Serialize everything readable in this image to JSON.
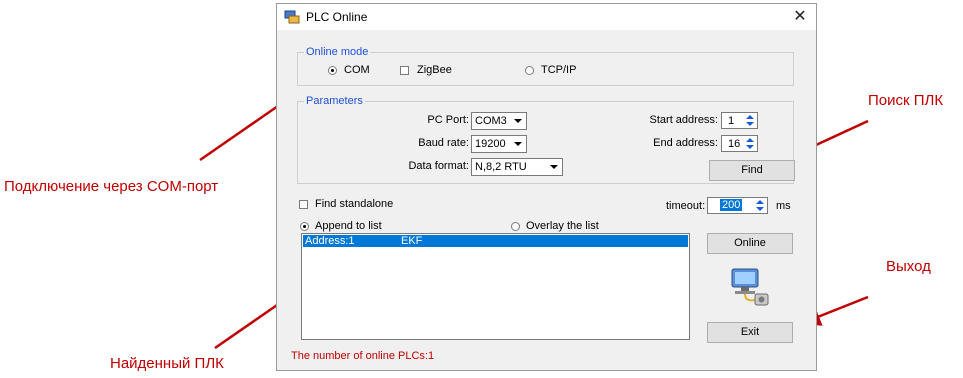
{
  "window": {
    "title": "PLC Online",
    "close_glyph": "✕"
  },
  "online_mode": {
    "legend": "Online mode",
    "options": [
      {
        "label": "COM",
        "kind": "radio",
        "selected": true
      },
      {
        "label": "ZigBee",
        "kind": "checkbox",
        "selected": false
      },
      {
        "label": "TCP/IP",
        "kind": "radio",
        "selected": false
      }
    ]
  },
  "parameters": {
    "legend": "Parameters",
    "pc_port": {
      "label": "PC Port:",
      "value": "COM3"
    },
    "baud_rate": {
      "label": "Baud rate:",
      "value": "19200"
    },
    "data_format": {
      "label": "Data format:",
      "value": "N,8,2 RTU"
    },
    "start_address": {
      "label": "Start address:",
      "value": "1"
    },
    "end_address": {
      "label": "End address:",
      "value": "16"
    },
    "find_button": "Find"
  },
  "find_standalone": {
    "label": "Find standalone",
    "checked": false
  },
  "timeout": {
    "label": "timeout:",
    "value": "200",
    "unit": "ms"
  },
  "list_mode": {
    "append": {
      "label": "Append to list",
      "selected": true
    },
    "overlay": {
      "label": "Overlay the list",
      "selected": false
    }
  },
  "found_list": [
    {
      "address": "Address:1",
      "name": "EKF",
      "selected": true
    }
  ],
  "buttons": {
    "online": "Online",
    "exit": "Exit"
  },
  "status_text": "The number of online PLCs:1",
  "annotations": {
    "com_port": "Подключение через COM-порт",
    "search": "Поиск ПЛК",
    "exit": "Выход",
    "found": "Найденный ПЛК"
  },
  "colors": {
    "legend": "#1f4fd8",
    "selection": "#0078d7",
    "status": "#c00000",
    "annotation": "#c00000"
  },
  "icons": [
    "plc-app-icon",
    "close-icon",
    "network-computer-icon"
  ]
}
